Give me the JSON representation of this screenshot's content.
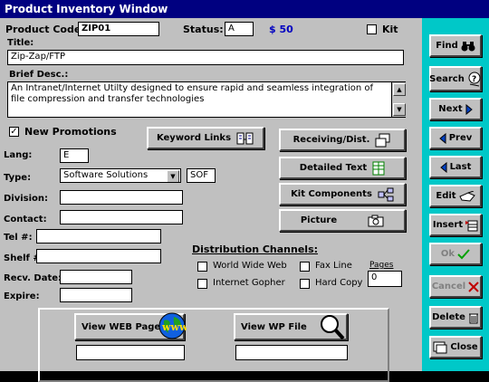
{
  "window": {
    "title": "Product Inventory Window"
  },
  "header": {
    "product_code_label": "Product Code:",
    "product_code": "ZIP01",
    "status_label": "Status:",
    "status": "A",
    "price": "$ 50",
    "kit_label": "Kit"
  },
  "title_field": {
    "label": "Title:",
    "value": "Zip-Zap/FTP"
  },
  "desc": {
    "label": "Brief Desc.:",
    "value": "An Intranet/Internet  Utilty designed to ensure rapid and seamless integration of file compression and transfer technologies"
  },
  "new_promotions": {
    "label": "New Promotions",
    "checked": true
  },
  "fields": {
    "lang_label": "Lang:",
    "lang": "E",
    "type_label": "Type:",
    "type": "Software Solutions",
    "type_code": "SOF",
    "division_label": "Division:",
    "contact_label": "Contact:",
    "tel_label": "Tel #:",
    "shelf_label": "Shelf #:",
    "recv_date_label": "Recv. Date:",
    "expire_label": "Expire:"
  },
  "actions": {
    "keyword_links": "Keyword Links",
    "receiving": "Receiving/Dist.",
    "detailed_text": "Detailed Text",
    "kit_components": "Kit Components",
    "picture": "Picture"
  },
  "distribution": {
    "label": "Distribution Channels:",
    "world_wide_web": "World Wide Web",
    "internet_gopher": "Internet Gopher",
    "fax_line": "Fax Line",
    "hard_copy": "Hard Copy",
    "pages_label": "Pages",
    "pages": "0"
  },
  "bottom": {
    "view_web_page": "View WEB Page",
    "view_wp_file": "View WP File"
  },
  "sidebar": {
    "find": "Find",
    "search": "Search",
    "next": "Next",
    "prev": "Prev",
    "last": "Last",
    "edit": "Edit",
    "insert": "Insert",
    "ok": "Ok",
    "cancel": "Cancel",
    "delete": "Delete",
    "close": "Close"
  },
  "colors": {
    "title_bar": "#000080",
    "sidebar": "#00c8c8",
    "price": "#0000c0",
    "ok_check": "#00a000",
    "cancel_x": "#c00000"
  }
}
